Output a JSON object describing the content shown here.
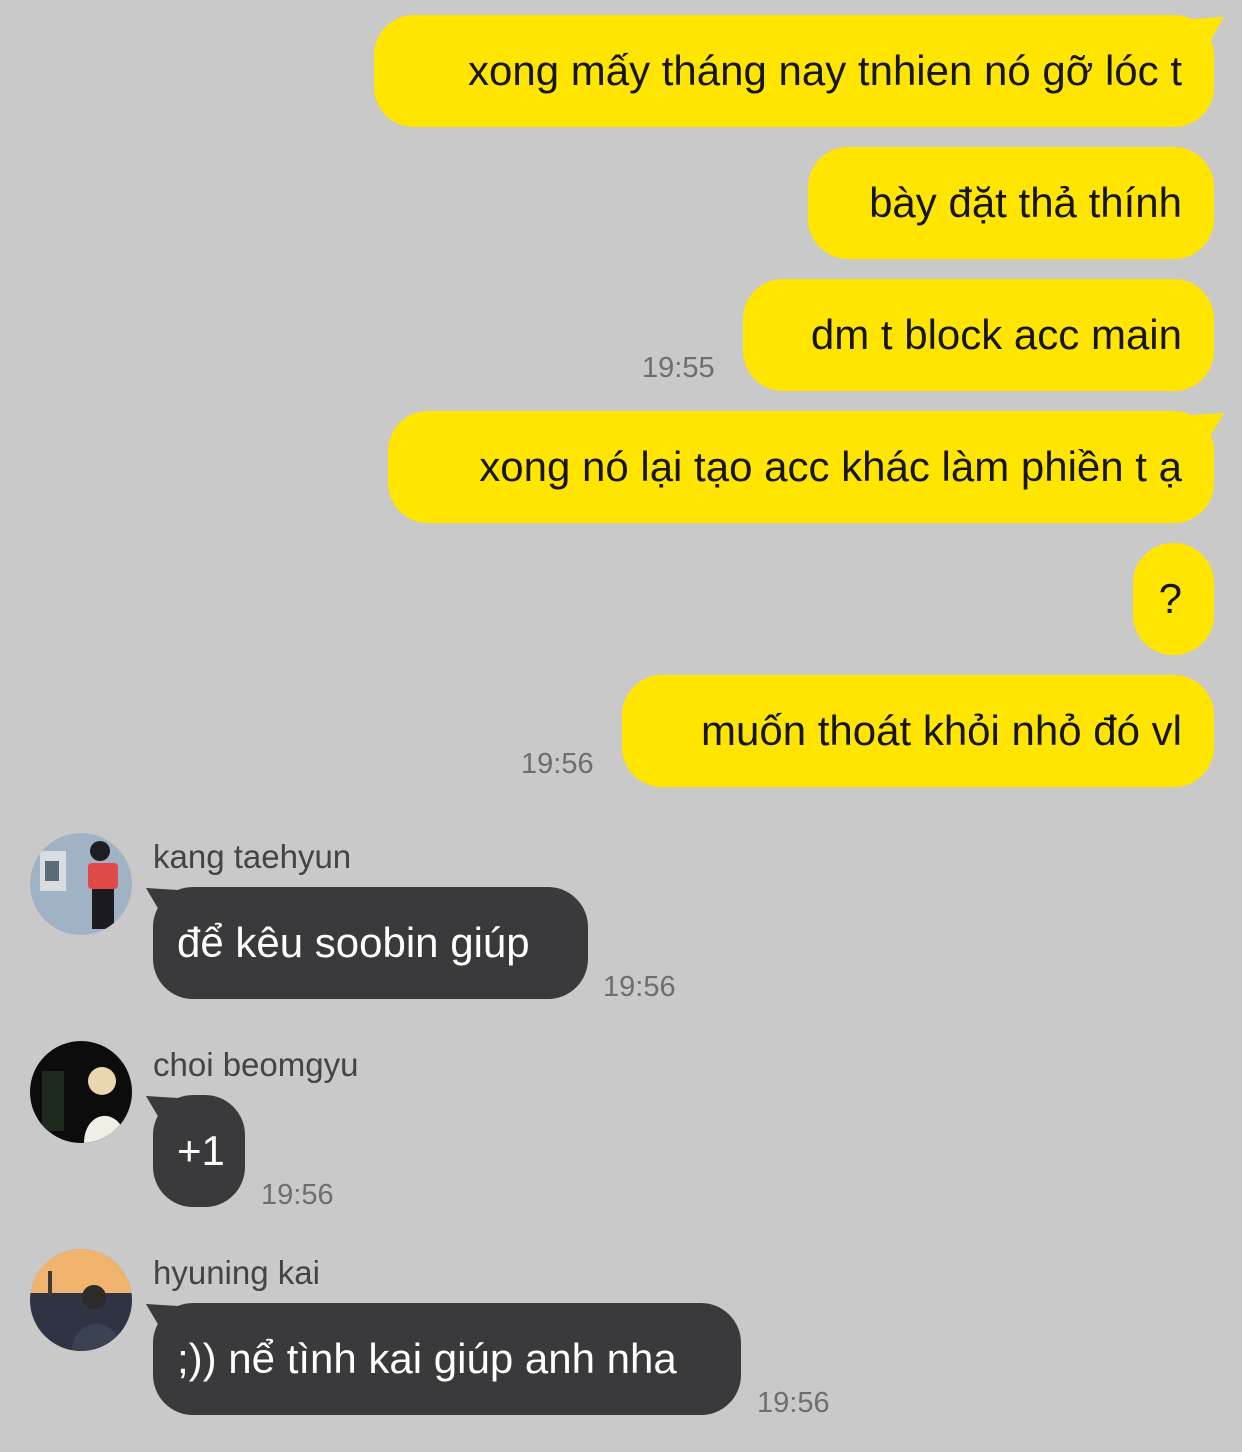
{
  "colors": {
    "background": "#c9c9c9",
    "outgoing_bubble": "#ffe500",
    "incoming_bubble": "#3a3a3c",
    "timestamp": "#6e6e6e",
    "sender_name": "#444444"
  },
  "outgoing": [
    {
      "text": "xong mấy tháng nay tnhien nó gỡ lóc t"
    },
    {
      "text": "bày đặt thả thính"
    },
    {
      "text": "dm t block acc main",
      "time": "19:55"
    },
    {
      "text": "xong nó lại tạo acc khác làm phiền t ạ"
    },
    {
      "text": "?"
    },
    {
      "text": "muốn thoát khỏi nhỏ đó vl",
      "time": "19:56"
    }
  ],
  "incoming": [
    {
      "sender": "kang taehyun",
      "avatar_icon": "user-avatar-icon",
      "text": "để kêu soobin giúp",
      "time": "19:56"
    },
    {
      "sender": "choi beomgyu",
      "avatar_icon": "user-avatar-icon",
      "text": "+1",
      "time": "19:56"
    },
    {
      "sender": "hyuning kai",
      "avatar_icon": "user-avatar-icon",
      "text": ";)) nể tình kai giúp anh nha",
      "time": "19:56"
    }
  ]
}
